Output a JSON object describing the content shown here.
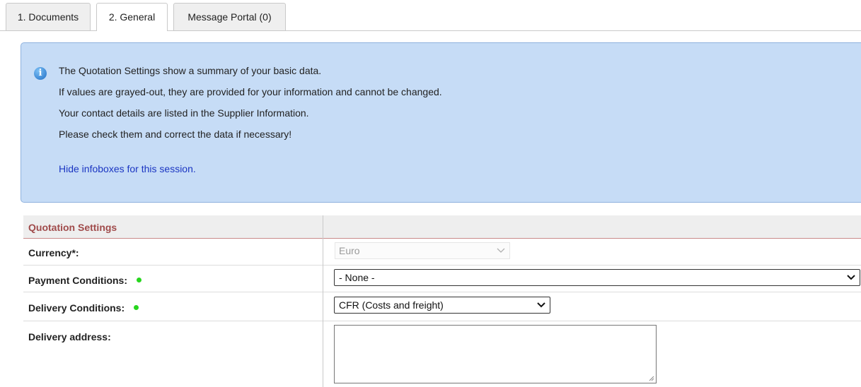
{
  "tabs": [
    {
      "label": "1. Documents",
      "active": false
    },
    {
      "label": "2. General",
      "active": true
    },
    {
      "label": "Message Portal (0)",
      "active": false
    }
  ],
  "infobox": {
    "icon": "info-icon",
    "lines": [
      "The Quotation Settings show a summary of your basic data.",
      "If values are grayed-out, they are provided for your information and cannot be changed.",
      "Your contact details are listed in the Supplier Information.",
      "Please check them and correct the data if necessary!"
    ],
    "hide_link": "Hide infoboxes for this session."
  },
  "settings": {
    "title": "Quotation Settings",
    "currency": {
      "label": "Currency*:",
      "value": "Euro",
      "disabled": true
    },
    "payment_conditions": {
      "label": "Payment Conditions:",
      "value": "- None -",
      "status_color": "#27d61e"
    },
    "delivery_conditions": {
      "label": "Delivery Conditions:",
      "value": "CFR (Costs and freight)",
      "status_color": "#27d61e"
    },
    "delivery_address": {
      "label": "Delivery address:",
      "value": ""
    }
  },
  "colors": {
    "infobox_bg": "#c6dcf6",
    "infobox_border": "#8fb2de",
    "section_title": "#a04b4b",
    "link": "#1a35c2"
  }
}
